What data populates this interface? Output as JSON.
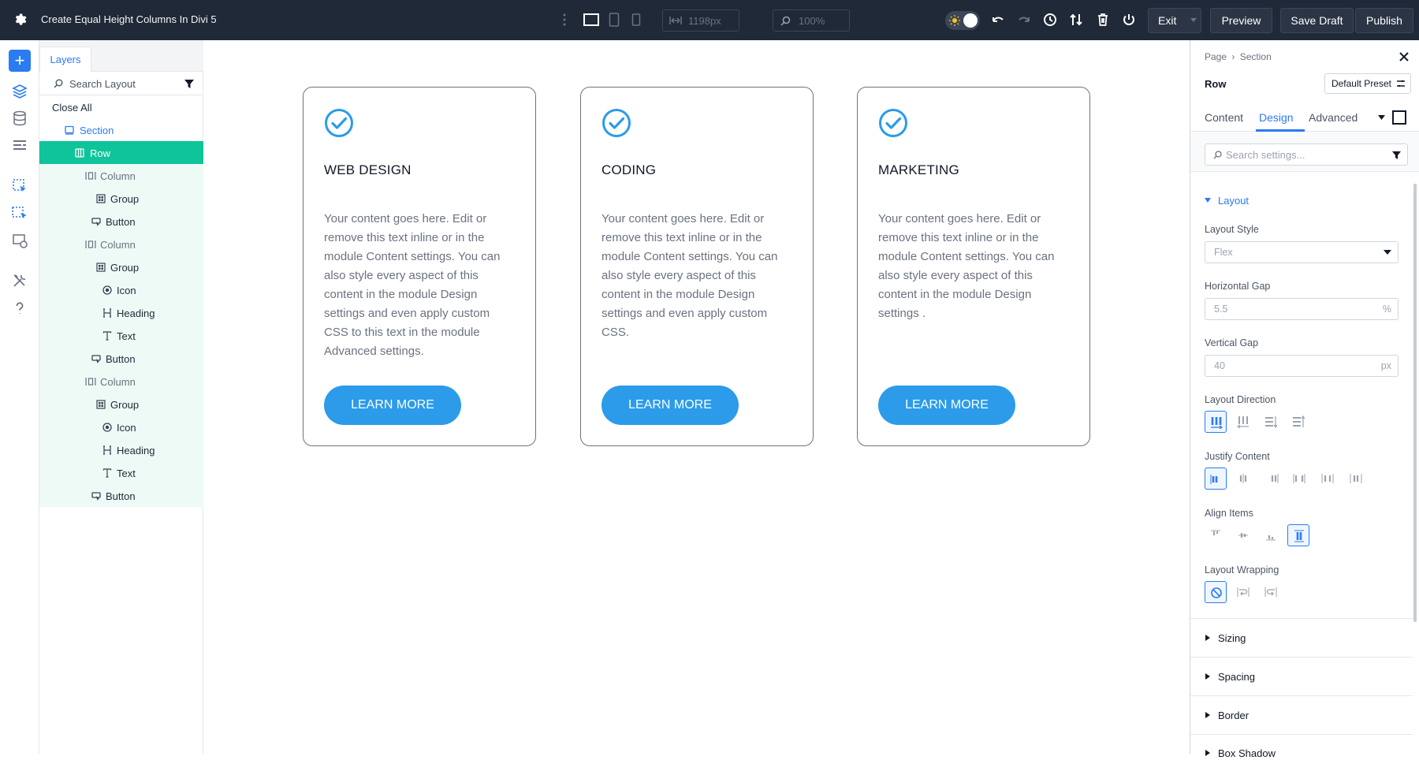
{
  "topbar": {
    "title": "Create Equal Height Columns In Divi 5",
    "width_value": "1198px",
    "zoom_value": "100%",
    "exit_label": "Exit",
    "preview_label": "Preview",
    "save_draft_label": "Save Draft",
    "publish_label": "Publish"
  },
  "layers": {
    "tab_label": "Layers",
    "search_placeholder": "Search Layout",
    "close_all_label": "Close All",
    "tree": [
      {
        "label": "Section",
        "icon": "section-icon"
      },
      {
        "label": "Row",
        "icon": "row-icon"
      },
      {
        "label": "Column",
        "icon": "column-icon"
      },
      {
        "label": "Group",
        "icon": "group-icon"
      },
      {
        "label": "Button",
        "icon": "button-module-icon"
      },
      {
        "label": "Column",
        "icon": "column-icon"
      },
      {
        "label": "Group",
        "icon": "group-icon"
      },
      {
        "label": "Icon",
        "icon": "icon-module-icon"
      },
      {
        "label": "Heading",
        "icon": "heading-icon"
      },
      {
        "label": "Text",
        "icon": "text-icon"
      },
      {
        "label": "Button",
        "icon": "button-module-icon"
      },
      {
        "label": "Column",
        "icon": "column-icon"
      },
      {
        "label": "Group",
        "icon": "group-icon"
      },
      {
        "label": "Icon",
        "icon": "icon-module-icon"
      },
      {
        "label": "Heading",
        "icon": "heading-icon"
      },
      {
        "label": "Text",
        "icon": "text-icon"
      },
      {
        "label": "Button",
        "icon": "button-module-icon"
      }
    ]
  },
  "canvas": {
    "cards": [
      {
        "heading": "WEB DESIGN",
        "body": "Your content goes here. Edit or remove this text inline or in the module Content settings. You can also style every aspect of this content in the module Design settings and even apply custom CSS to this text in the module Advanced settings.",
        "button": "LEARN MORE"
      },
      {
        "heading": "CODING",
        "body": "Your content goes here. Edit or remove this text inline or in the module Content settings. You can also style every aspect of this content in the module Design settings and even apply custom CSS.",
        "button": "LEARN MORE"
      },
      {
        "heading": "MARKETING",
        "body": "Your content goes here. Edit or remove this text inline or in the module Content settings. You can also style every aspect of this content in the module Design settings .",
        "button": "LEARN MORE"
      }
    ]
  },
  "settings": {
    "breadcrumb_page": "Page",
    "breadcrumb_sep": "›",
    "breadcrumb_section": "Section",
    "element_label": "Row",
    "preset_label": "Default Preset",
    "tabs": {
      "content": "Content",
      "design": "Design",
      "advanced": "Advanced"
    },
    "search_placeholder": "Search settings...",
    "layout_group": "Layout",
    "layout_style_label": "Layout Style",
    "layout_style_value": "Flex",
    "horizontal_gap_label": "Horizontal Gap",
    "horizontal_gap_value": "5.5",
    "horizontal_gap_unit": "%",
    "vertical_gap_label": "Vertical Gap",
    "vertical_gap_value": "40",
    "vertical_gap_unit": "px",
    "layout_direction_label": "Layout Direction",
    "justify_content_label": "Justify Content",
    "align_items_label": "Align Items",
    "layout_wrapping_label": "Layout Wrapping",
    "collapsed_groups": [
      "Sizing",
      "Spacing",
      "Border",
      "Box Shadow"
    ]
  },
  "colors": {
    "accent": "#2b7bf1",
    "active_layer": "#0fc39a",
    "card_button": "#2b9bea",
    "topbar": "#1f2937"
  }
}
